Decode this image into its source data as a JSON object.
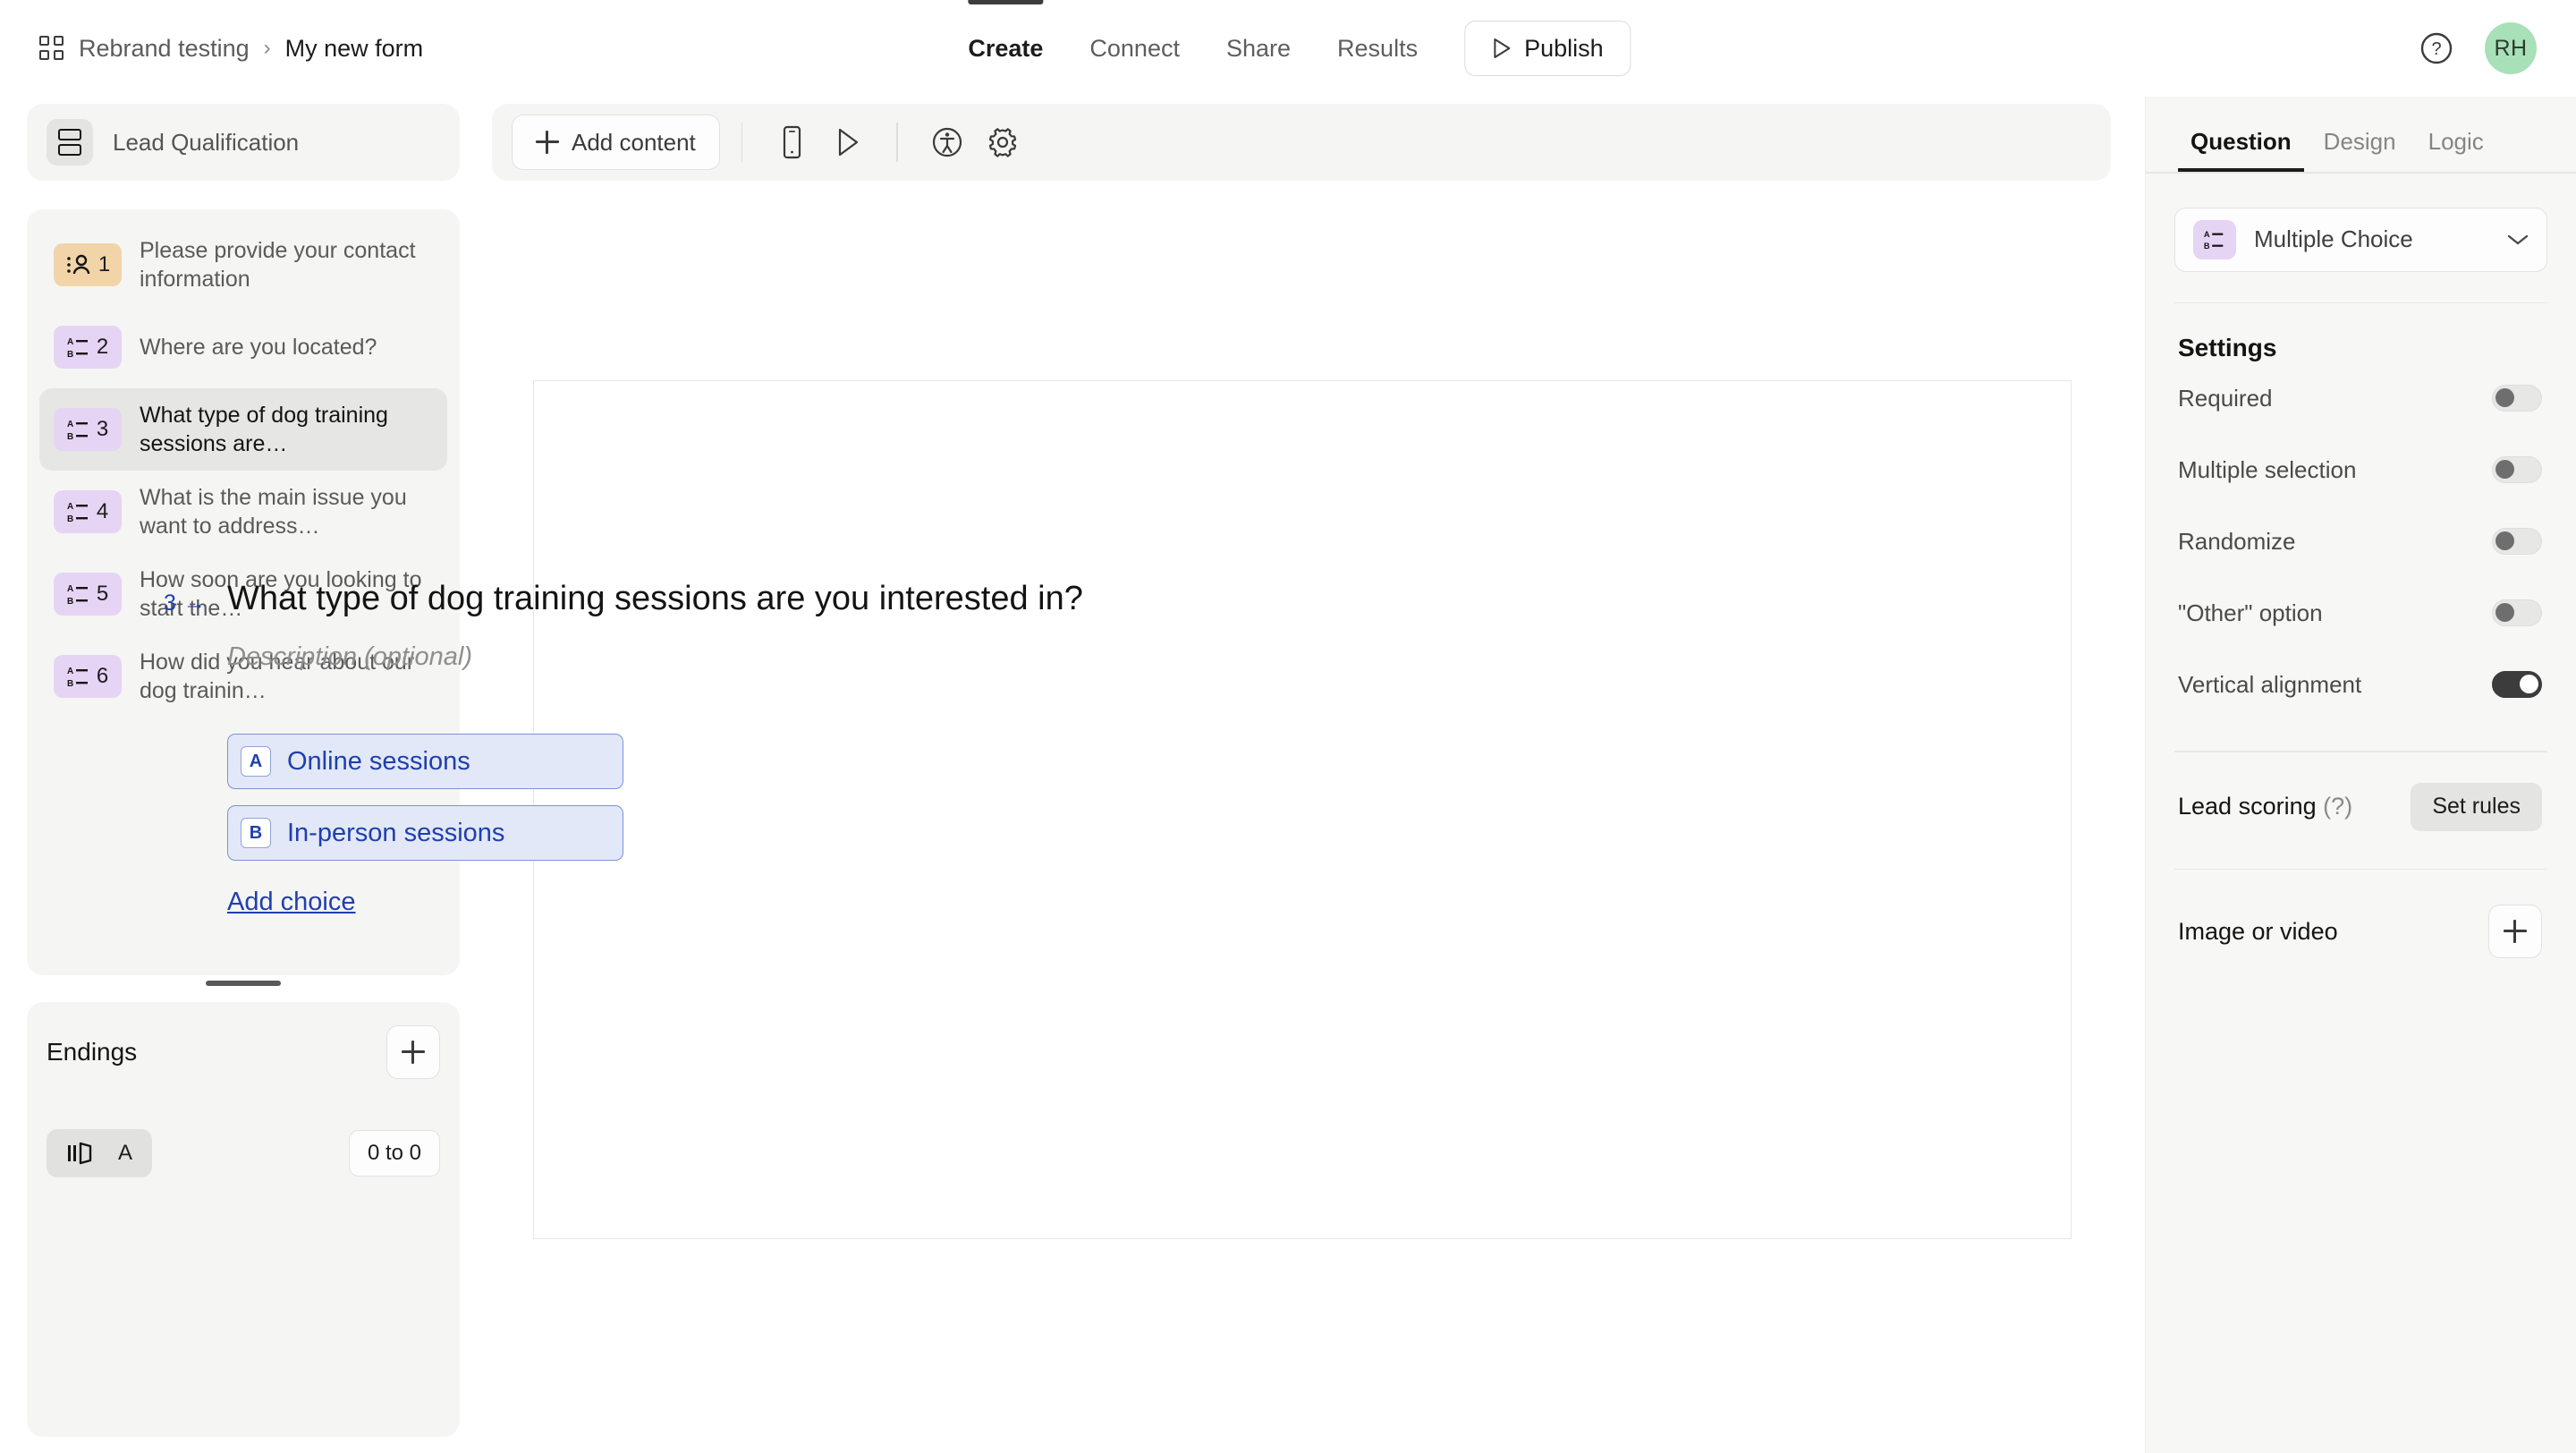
{
  "header": {
    "workspace_icon": "grid-icon",
    "workspace": "Rebrand testing",
    "separator": "›",
    "form_title": "My new form",
    "nav_tabs": [
      {
        "label": "Create",
        "active": true
      },
      {
        "label": "Connect",
        "active": false
      },
      {
        "label": "Share",
        "active": false
      },
      {
        "label": "Results",
        "active": false
      }
    ],
    "publish_label": "Publish",
    "publish_icon": "play-icon",
    "help_icon": "help-circle-icon",
    "avatar_initials": "RH",
    "avatar_color": "#a8e0b7"
  },
  "sidebar": {
    "section_icon": "stacked-rows-icon",
    "section_title": "Lead Qualification",
    "questions": [
      {
        "number": "1",
        "icon": "contact-info-icon",
        "badge_color": "#f1d5a8",
        "text": "Please provide your contact information",
        "selected": false
      },
      {
        "number": "2",
        "icon": "multiple-choice-icon",
        "badge_color": "#e6d4f5",
        "text": "Where are you located?",
        "selected": false
      },
      {
        "number": "3",
        "icon": "multiple-choice-icon",
        "badge_color": "#e6d4f5",
        "text": "What type of dog training sessions are…",
        "selected": true
      },
      {
        "number": "4",
        "icon": "multiple-choice-icon",
        "badge_color": "#e6d4f5",
        "text": "What is the main issue you want to address…",
        "selected": false
      },
      {
        "number": "5",
        "icon": "multiple-choice-icon",
        "badge_color": "#e6d4f5",
        "text": "How soon are you looking to start the…",
        "selected": false
      },
      {
        "number": "6",
        "icon": "multiple-choice-icon",
        "badge_color": "#e6d4f5",
        "text": "How did you hear about our dog trainin…",
        "selected": false
      }
    ],
    "endings": {
      "title": "Endings",
      "add_icon": "plus-icon",
      "item_icon": "ending-screen-icon",
      "item_letter": "A",
      "range_label": "0 to 0"
    }
  },
  "toolbar": {
    "add_content_label": "Add content",
    "add_content_icon": "plus-icon",
    "icons": [
      {
        "name": "mobile-preview-icon"
      },
      {
        "name": "preview-play-icon"
      },
      {
        "name": "accessibility-icon"
      },
      {
        "name": "settings-gear-icon"
      }
    ]
  },
  "canvas": {
    "question_number": "3",
    "question_arrow": "→",
    "question_number_color": "#1f3fae",
    "question_title": "What type of dog training sessions are you interested in?",
    "description_placeholder": "Description (optional)",
    "choices": [
      {
        "letter": "A",
        "text": "Online sessions"
      },
      {
        "letter": "B",
        "text": "In-person sessions"
      }
    ],
    "add_choice_label": "Add choice",
    "accent_color": "#1f3fae",
    "choice_bg": "#e2e8f8"
  },
  "right_panel": {
    "tabs": [
      {
        "label": "Question",
        "active": true
      },
      {
        "label": "Design",
        "active": false
      },
      {
        "label": "Logic",
        "active": false
      }
    ],
    "question_type": {
      "label": "Multiple Choice",
      "icon": "multiple-choice-icon",
      "chevron": "chevron-down-icon"
    },
    "settings_title": "Settings",
    "settings": [
      {
        "label": "Required",
        "on": false
      },
      {
        "label": "Multiple selection",
        "on": false
      },
      {
        "label": "Randomize",
        "on": false
      },
      {
        "label": "\"Other\" option",
        "on": false
      },
      {
        "label": "Vertical alignment",
        "on": true
      }
    ],
    "lead_scoring": {
      "label": "Lead scoring",
      "hint": "(?)",
      "button_label": "Set rules"
    },
    "media": {
      "label": "Image or video",
      "add_icon": "plus-icon"
    }
  }
}
